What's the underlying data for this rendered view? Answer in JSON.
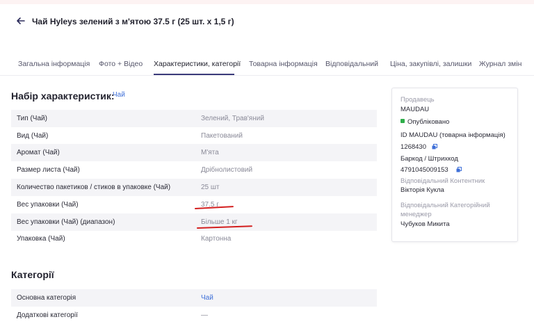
{
  "header": {
    "title": "Чай Hyleys зелений з м'ятою 37.5 г (25 шт. x 1,5 г)"
  },
  "tabs": [
    {
      "label": "Загальна інформація"
    },
    {
      "label": "Фото + Відео"
    },
    {
      "label": "Характеристики, категорії"
    },
    {
      "label": "Товарна інформація"
    },
    {
      "label": "Відповідальний"
    },
    {
      "label": "Ціна, закупівлі, залишки"
    },
    {
      "label": "Журнал змін"
    }
  ],
  "characteristics": {
    "title": "Набір характеристик:",
    "set_link": "Чай",
    "rows": [
      {
        "label": "Тип (Чай)",
        "value": "Зелений, Трав'яний"
      },
      {
        "label": "Вид (Чай)",
        "value": "Пакетований"
      },
      {
        "label": "Аромат (Чай)",
        "value": "М'ята"
      },
      {
        "label": "Размер листа (Чай)",
        "value": "Дрібнолистовий"
      },
      {
        "label": "Количество пакетиков / стиков в упаковке (Чай)",
        "value": "25 шт"
      },
      {
        "label": "Вес упаковки (Чай)",
        "value": "37.5 г"
      },
      {
        "label": "Вес упаковки (Чай) (диапазон)",
        "value": "Більше 1 кг"
      },
      {
        "label": "Упаковка (Чай)",
        "value": "Картонна"
      }
    ]
  },
  "categories": {
    "title": "Категорії",
    "rows": [
      {
        "label": "Основна категорія",
        "value": "Чай"
      },
      {
        "label": "Додаткові категорії",
        "value": "—"
      }
    ]
  },
  "card": {
    "seller_label": "Продавець",
    "seller": "MAUDAU",
    "status": "Опубліковано",
    "id_label": "ID MAUDAU (товарна інформація)",
    "id_value": "1268430",
    "barcode_label": "Баркод / Штрихкод",
    "barcode_value": "4791045009153",
    "content_manager_label": "Відповідальний Контентник",
    "content_manager": "Вікторія Кукла",
    "category_manager_label_1": "Відповідальний Категорійний",
    "category_manager_label_2": "менеджер",
    "category_manager": "Чубуков Микита"
  },
  "colors": {
    "accent": "#3e6fd8",
    "status": "#2fae4a",
    "annotation": "#d31f1f"
  }
}
